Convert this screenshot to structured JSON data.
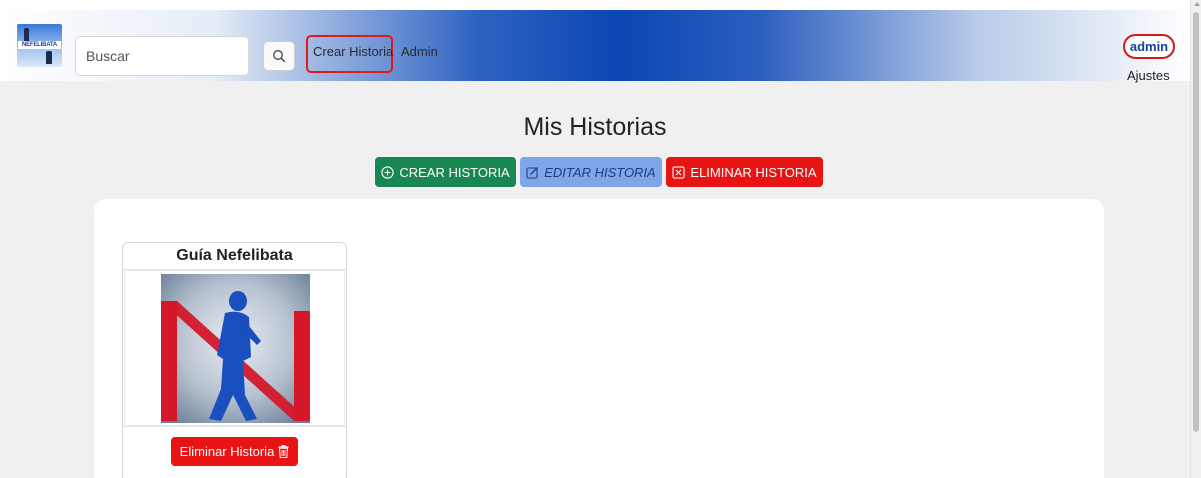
{
  "navbar": {
    "logo_text": "NEFELIBATA",
    "search_placeholder": "Buscar",
    "links": {
      "create_story": "Crear Historia",
      "admin": "Admin"
    },
    "user": {
      "name": "admin",
      "settings": "Ajustes"
    }
  },
  "main": {
    "title": "Mis Historias",
    "actions": {
      "create": "CREAR HISTORIA",
      "edit": "EDITAR HISTORIA",
      "delete": "ELIMINAR HISTORIA"
    },
    "stories": [
      {
        "title": "Guía Nefelibata",
        "delete_label": "Eliminar Historia"
      }
    ]
  },
  "colors": {
    "accent_red": "#e81414",
    "create_green": "#198754",
    "edit_blue": "#7fa6e8",
    "brand_blue": "#0a47b3"
  },
  "icons": {
    "search": "search-icon",
    "create": "plus-circle-icon",
    "edit": "pencil-square-icon",
    "delete": "x-square-icon",
    "trash": "trash-icon"
  }
}
